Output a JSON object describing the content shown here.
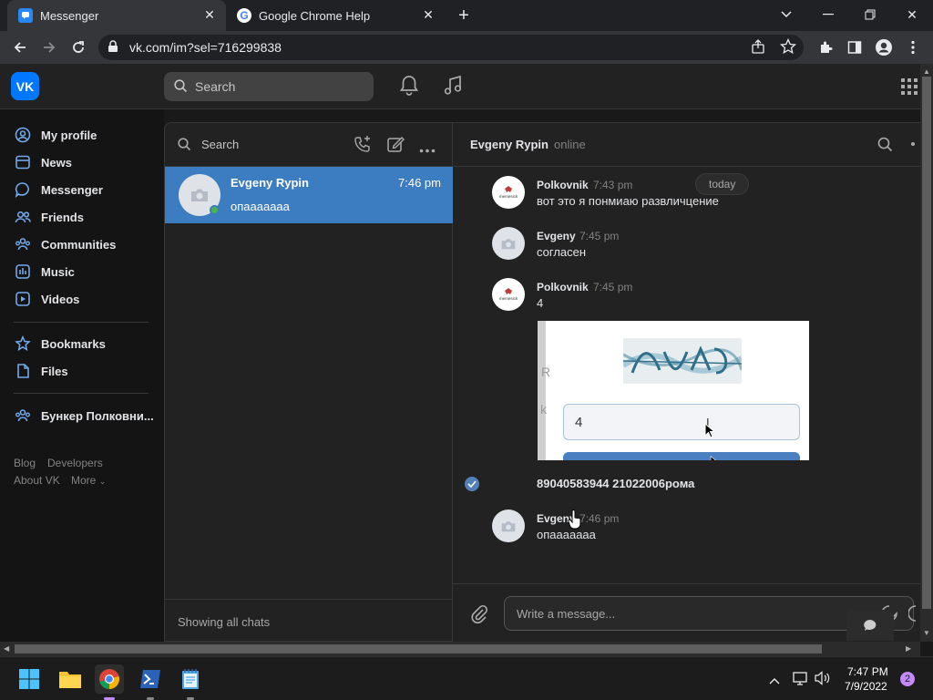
{
  "browser": {
    "tabs": [
      {
        "title": "Messenger",
        "icon": "vk-messenger-icon",
        "active": true
      },
      {
        "title": "Google Chrome Help",
        "icon": "google-icon",
        "active": false
      }
    ],
    "url": "vk.com/im?sel=716299838"
  },
  "vk": {
    "search_placeholder": "Search",
    "nav": [
      {
        "label": "My profile",
        "icon": "profile-icon"
      },
      {
        "label": "News",
        "icon": "news-icon"
      },
      {
        "label": "Messenger",
        "icon": "messenger-icon"
      },
      {
        "label": "Friends",
        "icon": "friends-icon"
      },
      {
        "label": "Communities",
        "icon": "communities-icon"
      },
      {
        "label": "Music",
        "icon": "music-icon"
      },
      {
        "label": "Videos",
        "icon": "videos-icon"
      },
      {
        "label": "Bookmarks",
        "icon": "bookmark-icon"
      },
      {
        "label": "Files",
        "icon": "files-icon"
      },
      {
        "label": "Бункер Полковни...",
        "icon": "group-icon"
      }
    ],
    "footer": {
      "blog": "Blog",
      "developers": "Developers",
      "about": "About VK",
      "more": "More"
    }
  },
  "chatlist": {
    "search_placeholder": "Search",
    "chat": {
      "name": "Evgeny Rypin",
      "time": "7:46 pm",
      "preview": "опааааааа"
    },
    "footer": "Showing all chats"
  },
  "conversation": {
    "name": "Evgeny Rypin",
    "status": "online",
    "date_badge": "today",
    "messages": [
      {
        "author": "Polkovnik",
        "time": "7:43 pm",
        "text": "вот это я понмиаю развличцение"
      },
      {
        "author": "Evgeny",
        "time": "7:45 pm",
        "text": "согласен"
      },
      {
        "author": "Polkovnik",
        "time": "7:45 pm",
        "text": "4",
        "captcha_input": "4",
        "side_letters": [
          "R",
          "k"
        ]
      },
      {
        "text": "89040583944 21022006рома"
      },
      {
        "author": "Evgeny",
        "time": "7:46 pm",
        "text": "опааааааа"
      }
    ],
    "avatar_label": "memesick",
    "composer_placeholder": "Write a message..."
  },
  "taskbar": {
    "time": "7:47 PM",
    "date": "7/9/2022",
    "notifications": "2"
  },
  "colors": {
    "accent": "#3c7cc0",
    "vk_blue": "#0077ff",
    "link": "#71aaeb"
  }
}
